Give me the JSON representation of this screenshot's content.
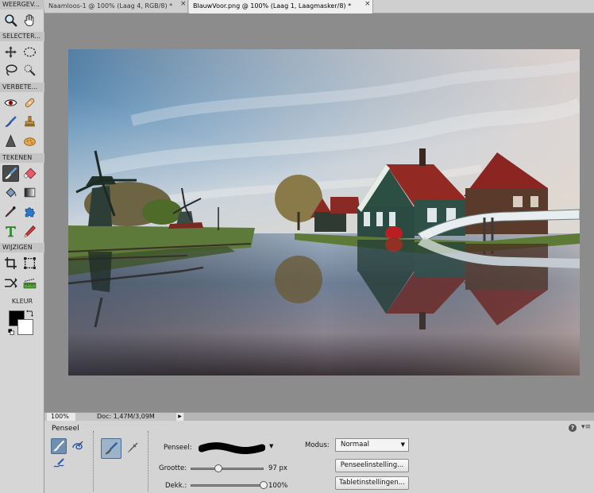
{
  "toolbox": {
    "sections": {
      "view": "WEERGEV...",
      "select": "SELECTER...",
      "enhance": "VERBETE...",
      "draw": "TEKENEN",
      "modify": "WIJZIGEN",
      "color": "KLEUR"
    },
    "colors": {
      "foreground": "#000000",
      "background": "#ffffff"
    },
    "active_tool": "brush-icon"
  },
  "tabs": [
    {
      "label": "Naamloos-1 @ 100% (Laag 4, RGB/8) *",
      "active": false
    },
    {
      "label": "BlauwVoor.png @ 100% (Laag 1, Laagmasker/8) *",
      "active": true
    }
  ],
  "tab_close_glyph": "×",
  "status": {
    "zoom": "100%",
    "doc": "Doc: 1,47M/3,09M",
    "arrow": "▶"
  },
  "options": {
    "title": "Penseel",
    "brush_label": "Penseel:",
    "size_label": "Grootte:",
    "size_value": "97 px",
    "size_fraction": 0.38,
    "opacity_label": "Dekk.:",
    "opacity_value": "100%",
    "opacity_fraction": 1.0,
    "mode_label": "Modus:",
    "mode_value": "Normaal",
    "brush_settings_button": "Penseelinstelling...",
    "tablet_settings_button": "Tabletinstellingen...",
    "help": "?",
    "menu": "▾≡"
  }
}
